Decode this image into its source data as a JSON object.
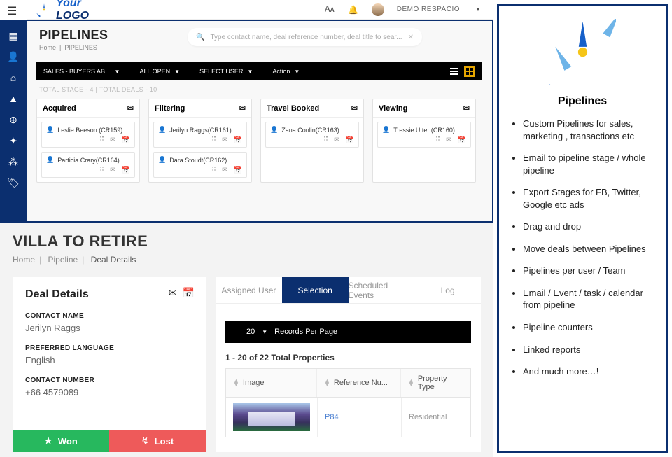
{
  "logo": {
    "top": "Your",
    "bottom": "LOGO"
  },
  "user": {
    "name": "DEMO RESPACIO"
  },
  "pipelines": {
    "title": "PIPELINES",
    "crumb_home": "Home",
    "crumb_current": "PIPELINES",
    "search_placeholder": "Type contact name, deal reference number, deal title to sear...",
    "filter_sales": "SALES - BUYERS AB...",
    "filter_open": "ALL OPEN",
    "filter_user": "SELECT USER",
    "filter_action": "Action",
    "totals": "TOTAL STAGE - 4  |  TOTAL DEALS - 10",
    "stages": [
      {
        "name": "Acquired",
        "deals": [
          {
            "name": "Leslie Beeson (CR159)"
          },
          {
            "name": "Particia Crary(CR164)"
          }
        ]
      },
      {
        "name": "Filtering",
        "deals": [
          {
            "name": "Jerilyn Raggs(CR161)"
          },
          {
            "name": "Dara Stoudt(CR162)"
          }
        ]
      },
      {
        "name": "Travel Booked",
        "deals": [
          {
            "name": "Zana Conlin(CR163)"
          }
        ]
      },
      {
        "name": "Viewing",
        "deals": [
          {
            "name": "Tressie Utter (CR160)"
          }
        ]
      }
    ]
  },
  "villa": {
    "title": "VILLA TO RETIRE",
    "crumb_home": "Home",
    "crumb_pipeline": "Pipeline",
    "crumb_current": "Deal Details",
    "dd_title": "Deal Details",
    "labels": {
      "contact": "CONTACT NAME",
      "lang": "PREFERRED LANGUAGE",
      "number": "CONTACT NUMBER"
    },
    "values": {
      "contact": "Jerilyn Raggs",
      "lang": "English",
      "number": "+66 4579089"
    },
    "won": "Won",
    "lost": "Lost",
    "tabs": {
      "assigned": "Assigned User",
      "selection": "Selection",
      "events": "Scheduled Events",
      "log": "Log"
    },
    "rpp_count": "20",
    "rpp_label": "Records Per Page",
    "results": "1 - 20 of 22 Total Properties",
    "cols": {
      "image": "Image",
      "ref": "Reference Nu...",
      "type": "Property Type"
    },
    "row": {
      "ref": "P84",
      "type": "Residential"
    }
  },
  "info": {
    "title": "Pipelines",
    "items": [
      "Custom Pipelines for sales, marketing , transactions etc",
      "Email to pipeline stage / whole pipeline",
      "Export Stages  for FB, Twitter, Google etc ads",
      "Drag and drop",
      "Move deals between Pipelines",
      "Pipelines per user / Team",
      "Email / Event  / task / calendar from pipeline",
      "Pipeline counters",
      "Linked reports",
      "And much more…!"
    ]
  }
}
